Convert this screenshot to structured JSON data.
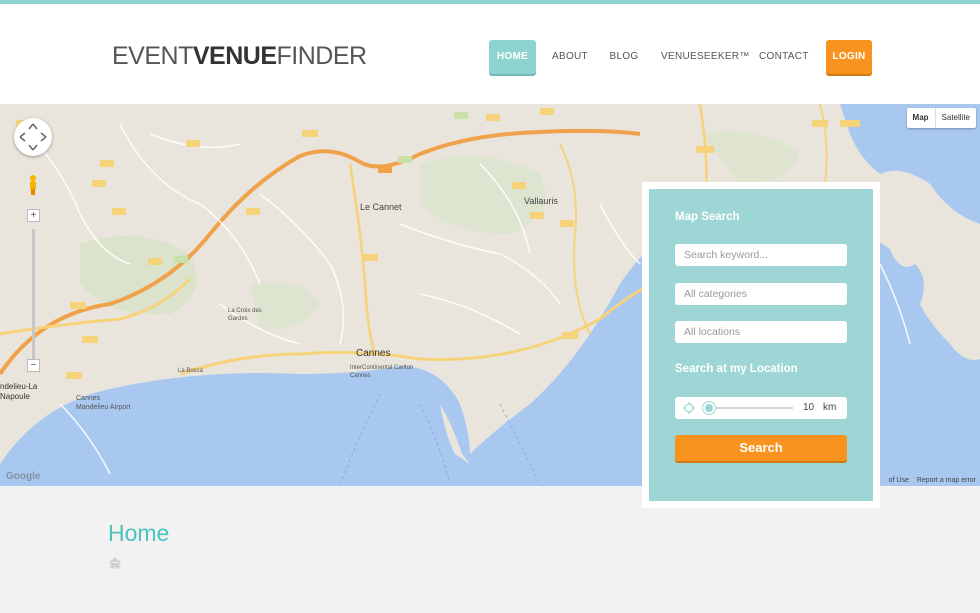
{
  "header": {
    "logo_light_1": "EVENT",
    "logo_bold": "VENUE",
    "logo_light_2": "FINDER"
  },
  "nav": {
    "home": "HOME",
    "about": "ABOUT",
    "blog": "BLOG",
    "venueseeker": "VENUESEEKER™",
    "contact": "CONTACT",
    "login": "LOGIN"
  },
  "map": {
    "type_map": "Map",
    "type_satellite": "Satellite",
    "zoom_in": "+",
    "zoom_out": "−",
    "terms": "of Use",
    "report": "Report a map error",
    "google": "Google",
    "places": {
      "cannes": "Cannes",
      "le_cannet": "Le Cannet",
      "vallauris": "Vallauris",
      "mandelieu": "Cannes Mandelieu Airport",
      "la_croix": "La Croix des Gardes",
      "la_bocca": "La Bocca",
      "intercontinental": "InterContinental Carlton Cannes",
      "napoule": "ndelieu-La Napoule"
    }
  },
  "search_panel": {
    "title": "Map Search",
    "keyword_placeholder": "Search keyword...",
    "categories": "All categories",
    "locations": "All locations",
    "location_title": "Search at my Location",
    "radius_value": "10",
    "radius_unit": "km",
    "radius_fraction": 0.0,
    "search_label": "Search"
  },
  "content": {
    "title": "Home"
  },
  "colors": {
    "accent_teal": "#8fd3d1",
    "accent_orange": "#f7931e",
    "title_teal": "#4bc2bc",
    "sea": "#a8c8f0"
  }
}
